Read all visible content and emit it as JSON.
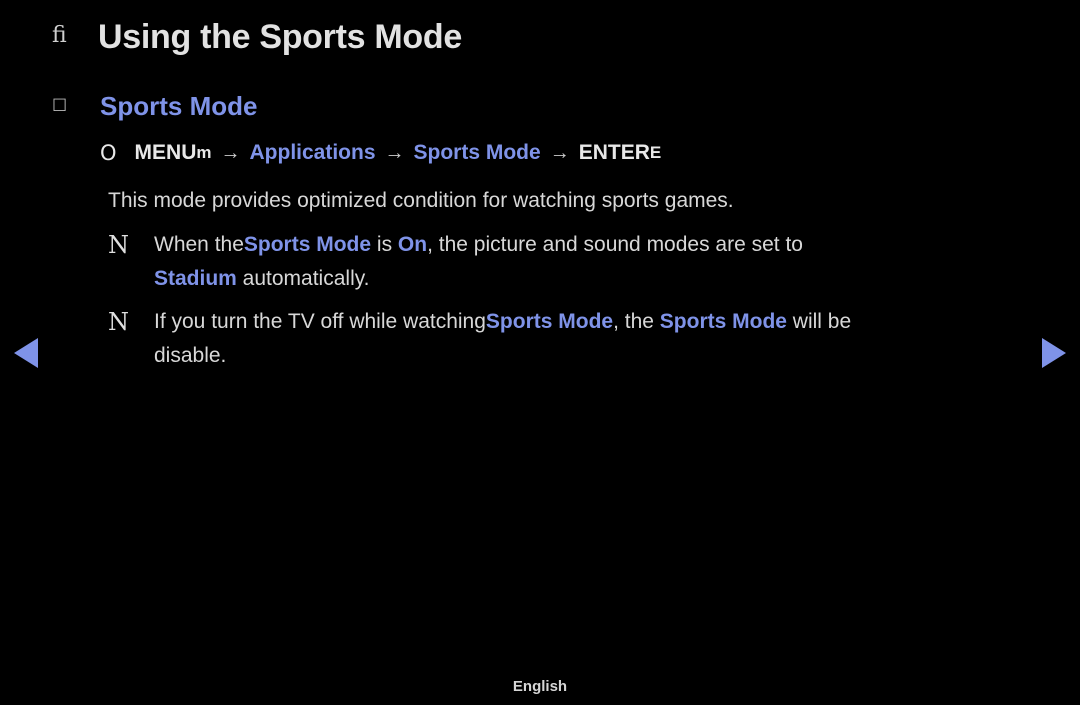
{
  "title": {
    "bullet": "fi",
    "text": "Using the Sports Mode"
  },
  "section": {
    "bullet": "☐",
    "text": "Sports Mode"
  },
  "menu_path": {
    "icon": "O",
    "menu_label": "MENU",
    "menu_sub": "m",
    "arrow1": "→",
    "item1": "Applications",
    "arrow2": "→",
    "item2": "Sports Mode",
    "arrow3": "→",
    "enter_label": "ENTER",
    "enter_sub": "E"
  },
  "paragraph": "This mode provides optimized condition for watching sports games.",
  "notes": [
    {
      "mark": "N",
      "part1": "When the",
      "highlight1": "Sports Mode",
      "part2": " is ",
      "highlight2": "On",
      "part3": ", the picture and sound modes are set to",
      "highlight3": "Stadium",
      "part4": " automatically."
    },
    {
      "mark": "N",
      "part1": "If you turn the TV off while watching",
      "highlight1": "Sports Mode",
      "part2": ", the ",
      "highlight2": "Sports Mode",
      "part3": " will be",
      "part4": "disable."
    }
  ],
  "nav": {
    "left_label": "previous-page",
    "right_label": "next-page"
  },
  "footer": {
    "language": "English"
  }
}
